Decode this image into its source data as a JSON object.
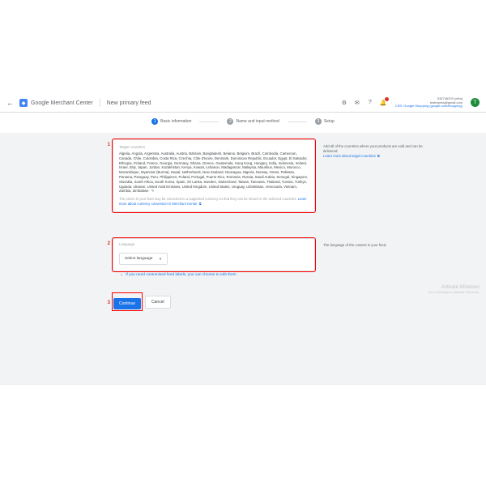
{
  "header": {
    "app_name": "Google Merchant Center",
    "page_title": "New primary feed",
    "account_id": "532746203 (eHa)",
    "account_email": "testerprita@gmail.com",
    "css_line": "CSS: Google Shopping (google.com/shopping)",
    "avatar_letter": "T"
  },
  "steps": {
    "s1": "Basic information",
    "s2": "Name and input method",
    "s3": "Setup"
  },
  "annotations": {
    "n1": "1",
    "n2": "2",
    "n3": "3"
  },
  "target": {
    "label": "Target countries",
    "countries": "Algeria, Angola, Argentina, Australia, Austria, Bahrain, Bangladesh, Belarus, Belgium, Brazil, Cambodia, Cameroon, Canada, Chile, Colombia, Costa Rica, Czechia, Côte d'Ivoire, Denmark, Dominican Republic, Ecuador, Egypt, El Salvador, Ethiopia, Finland, France, Georgia, Germany, Ghana, Greece, Guatemala, Hong Kong, Hungary, India, Indonesia, Ireland, Israel, Italy, Japan, Jordan, Kazakhstan, Kenya, Kuwait, Lebanon, Madagascar, Malaysia, Mauritius, Mexico, Morocco, Mozambique, Myanmar (Burma), Nepal, Netherlands, New Zealand, Nicaragua, Nigeria, Norway, Oman, Pakistan, Panama, Paraguay, Peru, Philippines, Poland, Portugal, Puerto Rico, Romania, Russia, Saudi Arabia, Senegal, Singapore, Slovakia, South Africa, South Korea, Spain, Sri Lanka, Sweden, Switzerland, Taiwan, Tanzania, Thailand, Tunisia, Türkiye, Uganda, Ukraine, United Arab Emirates, United Kingdom, United States, Uruguay, Uzbekistan, Venezuela, Vietnam, Zambia, Zimbabwe",
    "footer_before": "The prices in your feed may be converted to a supported currency so that they can be shown in the selected countries. ",
    "footer_link": "Learn more about currency conversion in Merchant Center",
    "side_text": "Add all of the countries where your products are sold and can be delivered.",
    "side_link": "Learn more about target countries"
  },
  "language": {
    "label": "Language",
    "select_placeholder": "Select language",
    "side_text": "The language of the content in your feed."
  },
  "custom_labels": "If you need customised feed labels, you can choose to edit them",
  "buttons": {
    "continue": "Continue",
    "cancel": "Cancel"
  },
  "watermark": {
    "line1": "Activate Windows",
    "line2": "Go to Settings to activate Windows."
  }
}
